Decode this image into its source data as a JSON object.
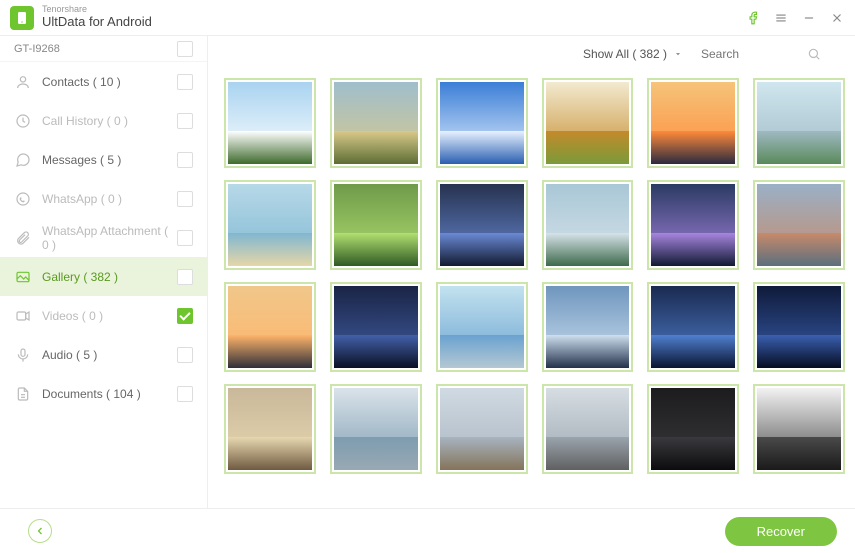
{
  "brand": {
    "vendor": "Tenorshare",
    "product": "UltData for Android"
  },
  "device": {
    "name": "GT-I9268"
  },
  "sidebar": {
    "items": [
      {
        "label": "Contacts ( 10 )",
        "enabled": true,
        "checked": false,
        "icon": "contact"
      },
      {
        "label": "Call History ( 0 )",
        "enabled": false,
        "checked": false,
        "icon": "clock"
      },
      {
        "label": "Messages ( 5 )",
        "enabled": true,
        "checked": false,
        "icon": "message"
      },
      {
        "label": "WhatsApp ( 0 )",
        "enabled": false,
        "checked": false,
        "icon": "whatsapp"
      },
      {
        "label": "WhatsApp Attachment ( 0 )",
        "enabled": false,
        "checked": false,
        "icon": "attachment"
      },
      {
        "label": "Gallery ( 382 )",
        "enabled": true,
        "checked": false,
        "icon": "gallery",
        "active": true
      },
      {
        "label": "Videos ( 0 )",
        "enabled": false,
        "checked": true,
        "icon": "video"
      },
      {
        "label": "Audio ( 5 )",
        "enabled": true,
        "checked": false,
        "icon": "audio"
      },
      {
        "label": "Documents ( 104 )",
        "enabled": true,
        "checked": false,
        "icon": "document"
      }
    ]
  },
  "toolbar": {
    "filter_label": "Show All ( 382 )",
    "search_placeholder": "Search"
  },
  "gallery": {
    "thumbs": [
      {
        "sky": "#a9d3f0",
        "ground": "#3e6b2c",
        "accent": "#ffffff"
      },
      {
        "sky": "#9fbecc",
        "ground": "#5d6d34",
        "accent": "#d9c98a"
      },
      {
        "sky": "#3b7ed6",
        "ground": "#2a5fb0",
        "accent": "#e8f2ff"
      },
      {
        "sky": "#f2ead0",
        "ground": "#7a9a3a",
        "accent": "#c48a2a"
      },
      {
        "sky": "#f5c47a",
        "ground": "#2a2a40",
        "accent": "#ff8a3a"
      },
      {
        "sky": "#cfe6ef",
        "ground": "#5a8a5a",
        "accent": "#9fb9c2"
      },
      {
        "sky": "#b7d9e8",
        "ground": "#e5d6a8",
        "accent": "#7fb7d1"
      },
      {
        "sky": "#6f9a4a",
        "ground": "#2f5a24",
        "accent": "#b2e070"
      },
      {
        "sky": "#26324f",
        "ground": "#121a30",
        "accent": "#6a8ad6"
      },
      {
        "sky": "#a9c7d6",
        "ground": "#3f6a4c",
        "accent": "#d7e3ea"
      },
      {
        "sky": "#2b3a63",
        "ground": "#111a33",
        "accent": "#a885e0"
      },
      {
        "sky": "#9ab0c6",
        "ground": "#5a6f7d",
        "accent": "#c88a6a"
      },
      {
        "sky": "#f0c78a",
        "ground": "#2f2f3a",
        "accent": "#ffb46a"
      },
      {
        "sky": "#1a2445",
        "ground": "#0b1024",
        "accent": "#4360a8"
      },
      {
        "sky": "#c2e2ef",
        "ground": "#b4c8d2",
        "accent": "#6aa2d0"
      },
      {
        "sky": "#6f96be",
        "ground": "#23314a",
        "accent": "#cfe0f0"
      },
      {
        "sky": "#1a2a50",
        "ground": "#0a1430",
        "accent": "#5080d0"
      },
      {
        "sky": "#0f1a3a",
        "ground": "#060c20",
        "accent": "#3a60b0"
      },
      {
        "sky": "#c9b89a",
        "ground": "#6f5a40",
        "accent": "#e8d8b0"
      },
      {
        "sky": "#d9e3ea",
        "ground": "#99a9b3",
        "accent": "#7d9cb0"
      },
      {
        "sky": "#d0dae2",
        "ground": "#84735a",
        "accent": "#a8b4c0"
      },
      {
        "sky": "#d6dee3",
        "ground": "#606060",
        "accent": "#9aa4ad"
      },
      {
        "sky": "#1c1c1e",
        "ground": "#0c0c0e",
        "accent": "#3a3a3e"
      },
      {
        "sky": "#f2f2f2",
        "ground": "#1a1a1a",
        "accent": "#4a4a4a"
      }
    ]
  },
  "footer": {
    "recover_label": "Recover"
  }
}
